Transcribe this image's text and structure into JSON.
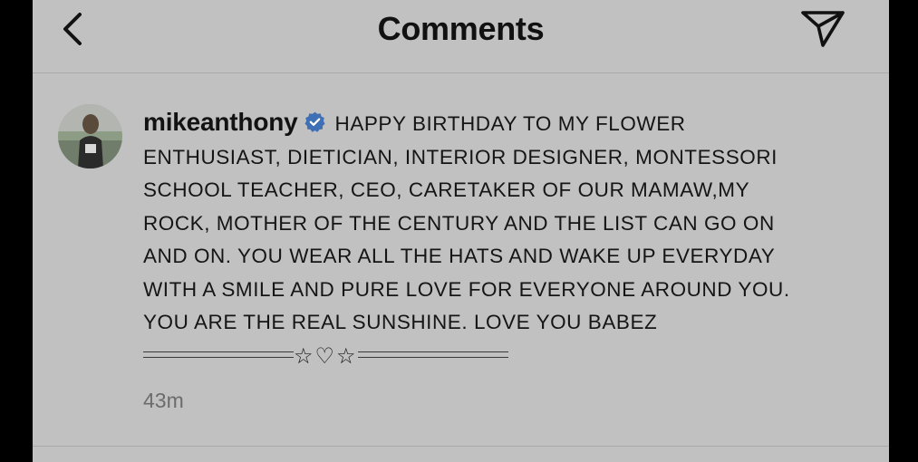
{
  "header": {
    "title": "Comments",
    "back_icon": "chevron-left-icon",
    "send_icon": "paper-plane-icon"
  },
  "comment": {
    "username": "mikeanthony",
    "verified": true,
    "lines": [
      "HAPPY BIRTHDAY TO MY FLOWER",
      "ENTHUSIAST, DIETICIAN, INTERIOR DESIGNER, MONTESSORI",
      "SCHOOL TEACHER, CEO, CARETAKER OF OUR MAMAW,MY",
      "ROCK, MOTHER OF THE CENTURY AND THE LIST CAN GO ON",
      "AND ON. YOU WEAR ALL THE HATS AND WAKE UP EVERYDAY",
      "WITH A SMILE AND PURE LOVE FOR EVERYONE AROUND YOU.",
      "YOU ARE THE REAL SUNSHINE. LOVE YOU BABEZ"
    ],
    "divider_symbols": "☆♡☆",
    "timestamp": "43m"
  },
  "colors": {
    "background": "#c1c1c1",
    "verified_badge": "#3f6fb5",
    "timestamp": "#6c6c6c"
  }
}
